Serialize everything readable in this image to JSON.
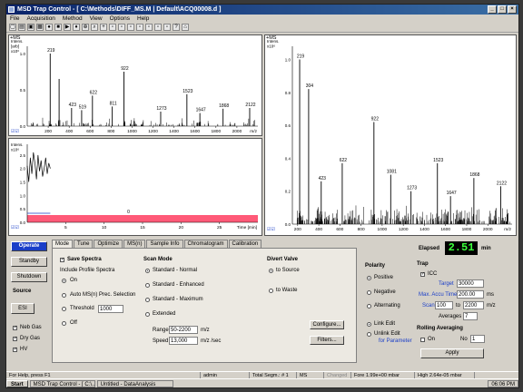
{
  "window": {
    "title": "MSD Trap Control - [ C:\\Methods\\DIFF_MS.M | Default\\ACQ00008.d ]",
    "controls": [
      "_",
      "□",
      "×"
    ]
  },
  "menu": [
    "File",
    "Acquisition",
    "Method",
    "View",
    "Options",
    "Help"
  ],
  "toolbar_icons": [
    "new-icon",
    "open-icon",
    "save-icon",
    "print-icon",
    "record-icon",
    "stop-icon",
    "play-icon",
    "tune-icon",
    "zoom-icon",
    "search-icon",
    "overlay-icon",
    "view1-icon",
    "view2-icon",
    "view3-icon",
    "view4-icon",
    "view5-icon",
    "view6-icon",
    "view7-icon",
    "help-icon",
    "lock-icon"
  ],
  "colors": {
    "accent": "#1a3ec8",
    "spectrum": "#000000",
    "tic_band": "#ff5a78",
    "elapsed_text": "#3cff3c"
  },
  "spectrum_small": {
    "tag": "+MS",
    "y_title": [
      "Intens.",
      "[arb]",
      "x10⁶"
    ],
    "y_ticks": [
      "1.0",
      "0.5",
      "0.0"
    ],
    "x_unit": "m/z",
    "chart_data": {
      "type": "bar",
      "x": [
        219,
        304,
        423,
        519,
        622,
        811,
        922,
        1273,
        1523,
        1647,
        1868,
        2122
      ],
      "labels": [
        "219",
        "",
        "423",
        "519",
        "622",
        "811",
        "922",
        "1273",
        "1523",
        "1647",
        "1868",
        "2122"
      ],
      "values": [
        1.0,
        0.65,
        0.25,
        0.22,
        0.42,
        0.27,
        0.75,
        0.2,
        0.44,
        0.18,
        0.24,
        0.25
      ],
      "xlim": [
        0,
        2200
      ],
      "x_ticks": [
        200,
        400,
        600,
        800,
        1000,
        1200,
        1400,
        1600,
        1800,
        2000
      ],
      "ylim": [
        0,
        1.1
      ]
    }
  },
  "chromatogram": {
    "y_title": [
      "Intens.",
      "x10⁶"
    ],
    "y_ticks": [
      "2.5",
      "2.0",
      "1.5",
      "1.0",
      "0.5",
      "0.0"
    ],
    "x_unit": "Time [min]",
    "annotation": "0",
    "chart_data": {
      "type": "line",
      "x": [
        0.0,
        0.2,
        0.4,
        0.6,
        0.8,
        1.0,
        1.2,
        1.4,
        1.6,
        1.8,
        2.0,
        2.2,
        2.4,
        2.6,
        2.8,
        3.0
      ],
      "values": [
        2.1,
        1.5,
        2.4,
        1.8,
        2.6,
        2.2,
        1.6,
        2.5,
        1.9,
        2.3,
        1.7,
        2.0,
        2.4,
        1.8,
        2.2,
        2.0
      ],
      "xlim": [
        0,
        30
      ],
      "x_ticks": [
        5,
        10,
        15,
        20,
        25
      ],
      "ylim": [
        0,
        2.9
      ]
    }
  },
  "spectrum_large": {
    "tag": "+MS",
    "y_title": [
      "Intens.",
      "x10⁶"
    ],
    "y_ticks": [
      "1.0",
      "0.8",
      "0.6",
      "0.4",
      "0.2",
      "0.0"
    ],
    "x_unit": "m/z",
    "chart_data": {
      "type": "bar",
      "x": [
        219,
        304,
        423,
        622,
        922,
        1081,
        1273,
        1523,
        1647,
        1868,
        2122
      ],
      "labels": [
        "219",
        "304",
        "423",
        "622",
        "922",
        "1081",
        "1273",
        "1523",
        "1647",
        "1868",
        "2122"
      ],
      "values": [
        1.0,
        0.82,
        0.26,
        0.37,
        0.62,
        0.3,
        0.2,
        0.37,
        0.17,
        0.28,
        0.23
      ],
      "xlim": [
        150,
        2230
      ],
      "x_ticks": [
        200,
        400,
        600,
        800,
        1000,
        1200,
        1400,
        1600,
        1800,
        2000
      ],
      "ylim": [
        0,
        1.08
      ]
    }
  },
  "left_buttons": {
    "operate": "Operate",
    "standby": "Standby",
    "shutdown": "Shutdown"
  },
  "source": {
    "label": "Source",
    "value": "ESI",
    "neb_gas": "Neb Gas",
    "dry_gas": "Dry Gas",
    "hv": "HV"
  },
  "tabs": [
    "Mode",
    "Tune",
    "Optimize",
    "MS(n)",
    "Sample Info",
    "Chromatogram",
    "Calibration"
  ],
  "mode": {
    "save_spectra": "Save Spectra",
    "include_profile": "Include Profile Spectra",
    "profile_options": [
      "On",
      "Auto MS(n) Prec. Selection",
      "Threshold",
      "Off"
    ],
    "threshold_value": "1000",
    "scan_mode_title": "Scan Mode",
    "scan_modes": [
      "Standard - Normal",
      "Standard - Enhanced",
      "Standard - Maximum",
      "Extended"
    ],
    "range_label": "Range",
    "range_value": "50-2200",
    "range_unit": "m/z",
    "speed_label": "Speed",
    "speed_value": "13,000",
    "speed_unit": "m/z /sec",
    "divert_title": "Divert Valve",
    "divert_options": [
      "to Source",
      "to Waste"
    ],
    "configure": "Configure...",
    "filters": "Filters..."
  },
  "polarity": {
    "title": "Polarity",
    "options": [
      "Positive",
      "Negative",
      "Alternating"
    ],
    "link_edit": "Link Edit",
    "unlink_edit": "Unlink Edit",
    "for_param": "for Parameter"
  },
  "elapsed": {
    "label": "Elapsed",
    "value": "2.51",
    "unit": "min"
  },
  "trap": {
    "title": "Trap",
    "icc": "ICC",
    "target_label": "Target",
    "target_value": "30000",
    "max_accu_label": "Max. Accu Time",
    "max_accu_value": "200.00",
    "max_accu_unit": "ms",
    "scan_label": "Scan",
    "scan_from": "100",
    "scan_to_label": "to",
    "scan_to": "2200",
    "scan_unit": "m/z",
    "averages_label": "Averages",
    "averages_value": "7"
  },
  "rolling": {
    "title": "Rolling Averaging",
    "on": "On",
    "no_label": "No",
    "no_value": "1",
    "apply": "Apply"
  },
  "statusbar": [
    "For Help, press F1",
    "admin",
    "Total Segm.: # 1",
    "MS",
    "Changed",
    "Fore 1.99e+00 mbar",
    "High 2.64e-05 mbar"
  ],
  "taskbar": {
    "start": "Start",
    "tasks": [
      "MSD Trap Control - [ C:\\...",
      "Untitled - DataAnalysis"
    ],
    "clock": "06:06 PM"
  }
}
